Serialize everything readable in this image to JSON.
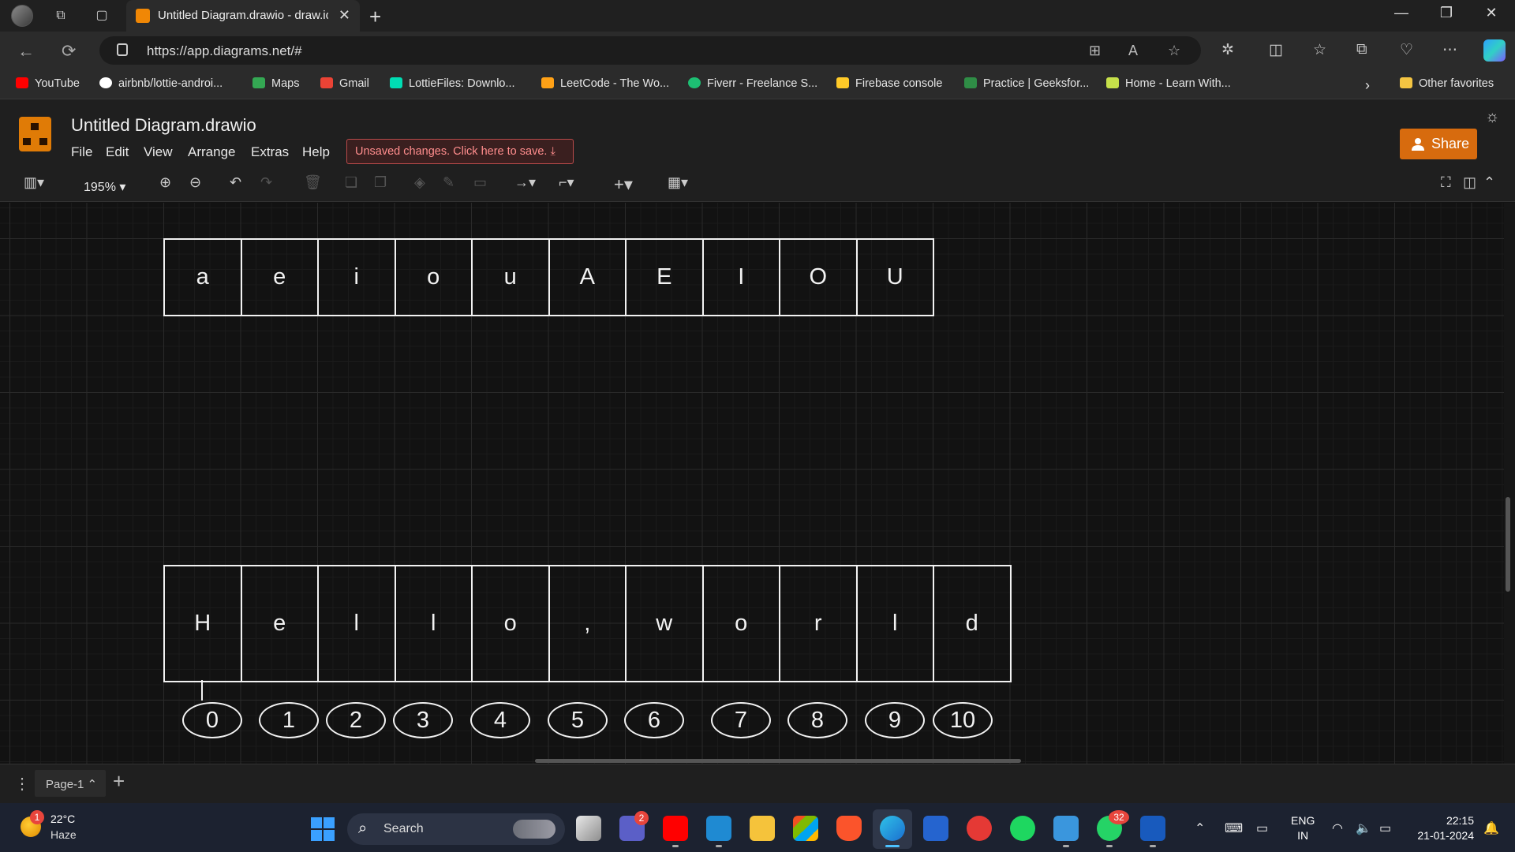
{
  "browser": {
    "tab_title": "Untitled Diagram.drawio - draw.io",
    "url": "https://app.diagrams.net/#",
    "favorites": [
      {
        "label": "YouTube",
        "color": "#ff0000"
      },
      {
        "label": "airbnb/lottie-androi...",
        "color": "#ffffff"
      },
      {
        "label": "Maps",
        "color": "#34a853"
      },
      {
        "label": "Gmail",
        "color": "#ea4335"
      },
      {
        "label": "LottieFiles: Downlo...",
        "color": "#00ddb3"
      },
      {
        "label": "LeetCode - The Wo...",
        "color": "#ffa116"
      },
      {
        "label": "Fiverr - Freelance S...",
        "color": "#1dbf73"
      },
      {
        "label": "Firebase console",
        "color": "#ffca28"
      },
      {
        "label": "Practice | Geeksfor...",
        "color": "#2f8d46"
      },
      {
        "label": "Home - Learn With...",
        "color": "#c6e04a"
      }
    ],
    "other_favorites": "Other favorites"
  },
  "app": {
    "title": "Untitled Diagram.drawio",
    "menu": [
      "File",
      "Edit",
      "View",
      "Arrange",
      "Extras",
      "Help"
    ],
    "unsaved": "Unsaved changes. Click here to save.",
    "share": "Share",
    "zoom": "195%",
    "brand_color": "#d76b0e"
  },
  "diagram": {
    "vowels": [
      "a",
      "e",
      "i",
      "o",
      "u",
      "A",
      "E",
      "I",
      "O",
      "U"
    ],
    "hello": [
      "H",
      "e",
      "l",
      "l",
      "o",
      ",",
      "w",
      "o",
      "r",
      "l",
      "d"
    ],
    "indices": [
      "0",
      "1",
      "2",
      "3",
      "4",
      "5",
      "6",
      "7",
      "8",
      "9",
      "10"
    ]
  },
  "pages": {
    "current": "Page-1"
  },
  "taskbar": {
    "temperature": "22°C",
    "weather": "Haze",
    "weather_badge": "1",
    "search": "Search",
    "teams_badge": "2",
    "whatsapp_badge": "32",
    "lang1": "ENG",
    "lang2": "IN",
    "time": "22:15",
    "date": "21-01-2024"
  }
}
